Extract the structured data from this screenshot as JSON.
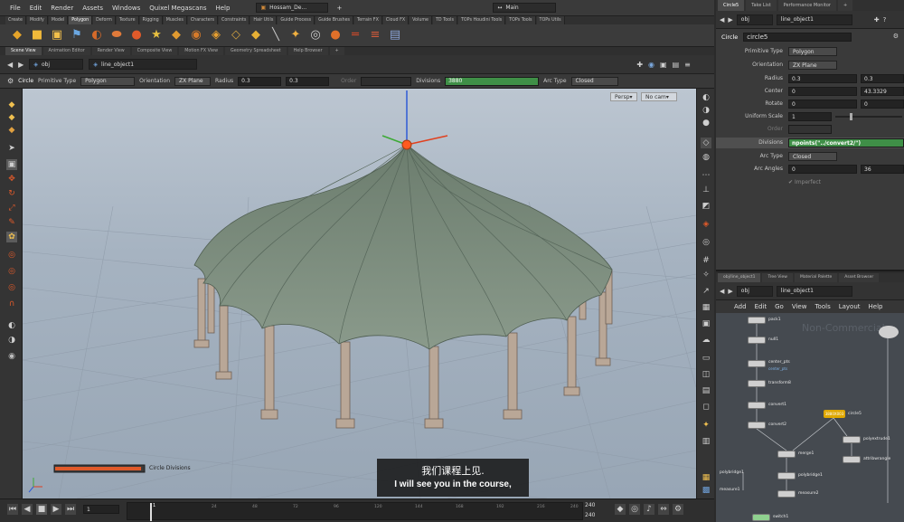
{
  "menu": [
    "File",
    "Edit",
    "Render",
    "Assets",
    "Windows",
    "Quixel Megascans",
    "Help"
  ],
  "title_tabs": {
    "file": "Hossam_De...",
    "desktop": "Main"
  },
  "shelf_tabs": [
    "Create",
    "Modify",
    "Model",
    "Polygon",
    "Deform",
    "Texture",
    "Rigging",
    "Muscles",
    "Characters",
    "Constraints",
    "Hair Utils",
    "Guide Process",
    "Guide Brushes",
    "Terrain FX",
    "Cloud FX",
    "Volume",
    "TD Tools",
    "TOPs Houdini Tools",
    "TOPs Tools",
    "TOPs Utils"
  ],
  "shelf_active": "Polygon",
  "pane_tabs": [
    "Scene View",
    "Animation Editor",
    "Render View",
    "Composite View",
    "Motion FX View",
    "Geometry Spreadsheet",
    "Help Browser"
  ],
  "path": {
    "context": "obj",
    "node": "line_object1"
  },
  "op_bar": {
    "node_type": "Circle",
    "primitive_type_label": "Primitive Type",
    "primitive_type_value": "Polygon",
    "orientation_label": "Orientation",
    "orientation_value": "ZX Plane",
    "radius_label": "Radius",
    "radius_x": "0.3",
    "radius_y": "0.3",
    "order_label": "Order",
    "divisions_label": "Divisions",
    "divisions_value": "3880",
    "arc_type_label": "Arc Type",
    "arc_type_value": "Closed"
  },
  "viewport": {
    "persp": "Persp",
    "cam": "No cam",
    "slider_label": "Circle Divisions",
    "slider_value": 0.97
  },
  "timeline": {
    "frame": "1",
    "start": "1",
    "end": "240",
    "end2": "240",
    "ticks": [
      "1",
      "24",
      "48",
      "72",
      "96",
      "120",
      "144",
      "168",
      "192",
      "216",
      "240"
    ]
  },
  "right_tabs": [
    "Circle5",
    "Take List",
    "Performance Monitor"
  ],
  "right_path": {
    "context": "obj",
    "node": "line_object1"
  },
  "params": {
    "node_type": "Circle",
    "node_name": "circle5",
    "rows": [
      {
        "label": "Primitive Type",
        "value": "Polygon"
      },
      {
        "label": "Orientation",
        "value": "ZX Plane"
      },
      {
        "label": "Radius",
        "v1": "0.3",
        "v2": "0.3"
      },
      {
        "label": "Center",
        "v1": "0",
        "v2": "43.3329"
      },
      {
        "label": "Rotate",
        "v1": "0",
        "v2": "0"
      },
      {
        "label": "Uniform Scale",
        "v1": "1"
      },
      {
        "label": "Order",
        "v1": ""
      },
      {
        "label": "Divisions",
        "v1": "npoints(\"../convert2/\")"
      },
      {
        "label": "Arc Type",
        "value": "Closed"
      },
      {
        "label": "Arc Angles",
        "v1": "0",
        "v2": "36"
      }
    ],
    "imperfect": "Imperfect"
  },
  "net_tabs": [
    "obj/line_object1",
    "Tree View",
    "Material Palette",
    "Asset Browser"
  ],
  "net_path": {
    "context": "obj",
    "node": "line_object1"
  },
  "net_menu": [
    "Add",
    "Edit",
    "Go",
    "View",
    "Tools",
    "Layout",
    "Help"
  ],
  "net_watermark": "Non-Commercial",
  "nodes": [
    {
      "name": "pack1"
    },
    {
      "name": "null1"
    },
    {
      "name": "center_pts",
      "sub": "center_pts"
    },
    {
      "name": "transform8"
    },
    {
      "name": "convert1"
    },
    {
      "name": "convert2"
    },
    {
      "name": "circle5",
      "badge": "3880X003"
    },
    {
      "name": "polyextrude1"
    },
    {
      "name": "merge1"
    },
    {
      "name": "attribwrangle"
    },
    {
      "name": "polybridge1"
    },
    {
      "name": "polybridge1"
    },
    {
      "name": "measure1"
    },
    {
      "name": "measure2"
    },
    {
      "name": "switch1"
    }
  ],
  "subtitle": {
    "cn": "我们课程上见.",
    "en": "I will see you in the course,"
  },
  "colors": {
    "accent_green": "#3f8f47",
    "selected_node": "#e0a800",
    "orange_gizmo": "#ff5a1f"
  }
}
